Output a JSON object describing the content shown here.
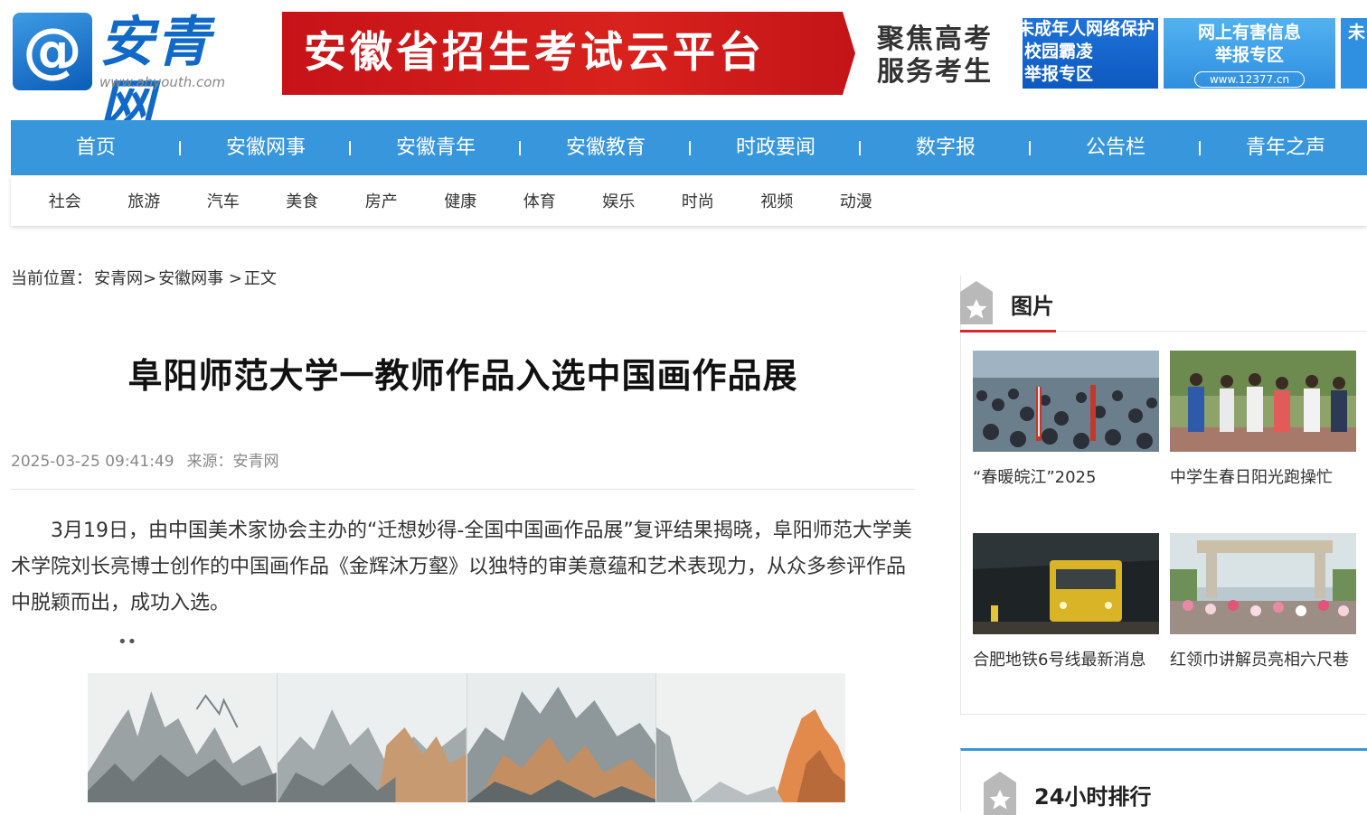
{
  "header": {
    "logo_mark": "@",
    "logo_name": "安青网",
    "logo_url": "www.ahyouth.com",
    "banner_main": "安徽省招生考试云平台",
    "banner_side": [
      "聚焦高考",
      "服务考生"
    ],
    "promo_1": [
      "未成年人网络保护",
      "校园霸凌",
      "举报专区"
    ],
    "promo_2": [
      "网上有害信息",
      "举报专区",
      "www.12377.cn"
    ],
    "promo_3": [
      "未"
    ]
  },
  "nav": {
    "main": [
      "首页",
      "安徽网事",
      "安徽青年",
      "安徽教育",
      "时政要闻",
      "数字报",
      "公告栏",
      "青年之声"
    ],
    "sub": [
      "社会",
      "旅游",
      "汽车",
      "美食",
      "房产",
      "健康",
      "体育",
      "娱乐",
      "时尚",
      "视频",
      "动漫"
    ]
  },
  "breadcrumb": {
    "prefix": "当前位置：",
    "home": "安青网",
    "sep1": ">",
    "section": "安徽网事",
    "sep2": " >",
    "current": "正文"
  },
  "article": {
    "title": "阜阳师范大学一教师作品入选中国画作品展",
    "date": "2025-03-25 09:41:49",
    "source": "来源：安青网",
    "body": "3月19日，由中国美术家协会主办的“迁想妙得-全国中国画作品展”复评结果揭晓，阜阳师范大学美术学院刘长亮博士创作的中国画作品《金辉沐万壑》以独特的审美意蕴和艺术表现力，从众多参评作品中脱颖而出，成功入选。",
    "dots": "••"
  },
  "sidebar": {
    "pictures_title": "图片",
    "pictures": [
      {
        "caption": "“春暖皖江”2025"
      },
      {
        "caption": "中学生春日阳光跑操忙"
      },
      {
        "caption": "合肥地铁6号线最新消息"
      },
      {
        "caption": "红领巾讲解员亮相六尺巷"
      }
    ],
    "ranking_title": "24小时排行"
  },
  "colors": {
    "nav_blue": "#3897dc",
    "banner_red": "#d8221d",
    "accent_red": "#d42a2a",
    "logo_blue": "#1169c7"
  }
}
